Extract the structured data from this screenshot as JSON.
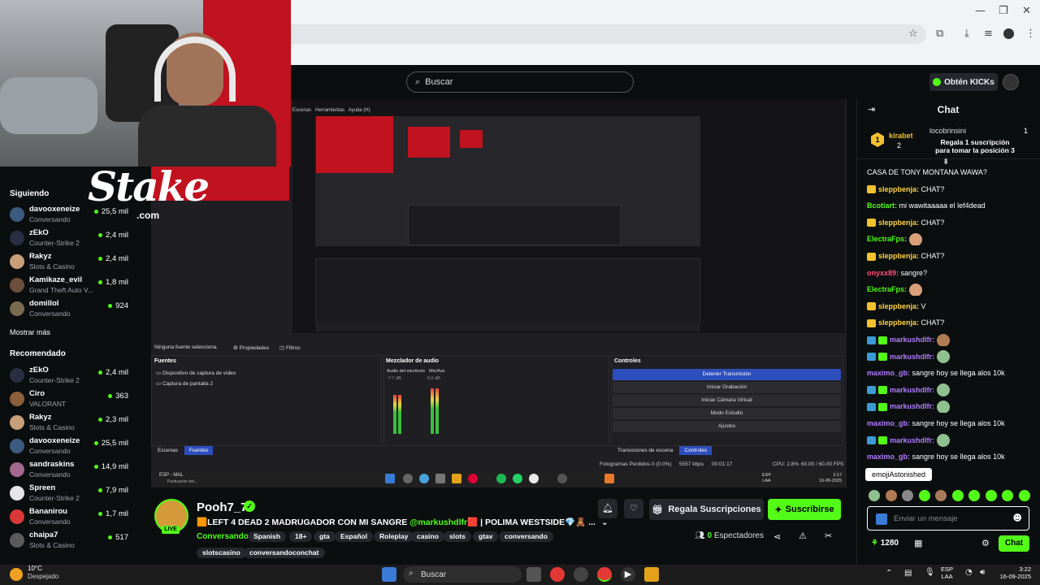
{
  "browser": {
    "icons": [
      "star-icon",
      "extensions-icon",
      "download-icon",
      "playlist-icon",
      "profile-icon",
      "menu-icon"
    ]
  },
  "header": {
    "search_placeholder": "Buscar",
    "kicks_label": "Obtén KICKs"
  },
  "webcam": {
    "sponsor": "Stake",
    "sponsor_domain": ".com"
  },
  "sidebar": {
    "following_title": "Siguiendo",
    "following": [
      {
        "name": "davooxeneize",
        "category": "Conversando",
        "viewers": "25,5 mil",
        "color": "#3d5a80"
      },
      {
        "name": "zEkO",
        "category": "Counter-Strike 2",
        "viewers": "2,4 mil",
        "color": "#2b2d42"
      },
      {
        "name": "Rakyz",
        "category": "Slots & Casino",
        "viewers": "2,4 mil",
        "color": "#c89f7a"
      },
      {
        "name": "Kamikaze_evil",
        "category": "Grand Theft Auto V...",
        "viewers": "1,8 mil",
        "color": "#6b4f3a"
      },
      {
        "name": "domillol",
        "category": "Conversando",
        "viewers": "924",
        "color": "#7a6a4f"
      }
    ],
    "show_more": "Mostrar más",
    "recommended_title": "Recomendado",
    "recommended": [
      {
        "name": "zEkO",
        "category": "Counter-Strike 2",
        "viewers": "2,4 mil",
        "color": "#2b2d42"
      },
      {
        "name": "Ciro",
        "category": "VALORANT",
        "viewers": "363",
        "color": "#8b5e3c"
      },
      {
        "name": "Rakyz",
        "category": "Slots & Casino",
        "viewers": "2,3 mil",
        "color": "#c89f7a"
      },
      {
        "name": "davooxeneize",
        "category": "Conversando",
        "viewers": "25,5 mil",
        "color": "#3d5a80"
      },
      {
        "name": "sandraskins",
        "category": "Conversando",
        "viewers": "14,9 mil",
        "color": "#a3688f"
      },
      {
        "name": "Spreen",
        "category": "Counter-Strike 2",
        "viewers": "7,9 mil",
        "color": "#e5e5e5"
      },
      {
        "name": "Bananirou",
        "category": "Conversando",
        "viewers": "1,7 mil",
        "color": "#d93838"
      },
      {
        "name": "chaipa7",
        "category": "Slots & Casino",
        "viewers": "517",
        "color": "#5a5a5a"
      }
    ]
  },
  "obs": {
    "menu": [
      "Escenas",
      "Herramientas",
      "Ayuda (H)"
    ],
    "no_source": "Ninguna fuente selecciona",
    "props": "Propiedades",
    "filters": "Filtros",
    "sources_title": "Fuentes",
    "sources": [
      "Dispositivo de captura de video",
      "Captura de pantalla 2"
    ],
    "mixer_title": "Mezclador de audio",
    "mixer_channels": [
      "Audio del escritorio",
      "Mic/Aux"
    ],
    "mixer_db": [
      "-7.7 dB",
      "-9.0 dB"
    ],
    "controls_title": "Controles",
    "controls": [
      "Detener Transmisión",
      "Iniciar Grabación",
      "Iniciar Cámara Virtual",
      "Modo Estudio",
      "Ajustes"
    ],
    "tabs_left": [
      "Escenas",
      "Fuentes"
    ],
    "tabs_right": [
      "Transiciones de escena",
      "Controles"
    ],
    "status": {
      "dropped": "Fotogramas Perdidos 0 (0.0%)",
      "kbps": "5557 kbps",
      "time": "00:01:17",
      "cpu": "CPU: 2.8%",
      "fps": "60.00 / 60.00 FPS"
    },
    "inner_taskbar": {
      "weather": "ESP - MAL",
      "sub": "Puntuación del...",
      "lang": "ESP",
      "lang2": "LAA",
      "time": "3:17",
      "date": "16-09-2025"
    }
  },
  "stream": {
    "channel": "Pooh7_7",
    "live": "LIVE",
    "title_pre": "🟧LEFT 4 DEAD 2 MADRUGADOR CON MI SANGRE ",
    "title_mention": "@markushdlfr",
    "title_post": "🟥 | POLIMA WESTSIDE💎🧸 ...",
    "category": "Conversando",
    "tags": [
      "Spanish",
      "18+",
      "gta",
      "Español",
      "Roleplay",
      "casino",
      "slots",
      "gtav",
      "conversando",
      "slotscasino",
      "conversandoconchat"
    ],
    "gift_label": "Regala Suscripciones",
    "subscribe_label": "Suscribirse",
    "viewers_count": "0",
    "viewers_label": "Espectadores"
  },
  "chat": {
    "title": "Chat",
    "leaderboard": {
      "user1": "kirabet",
      "user1_count": "2",
      "user2": "locobrinsini",
      "user2_count": "1",
      "cta": "Regala 1 suscripción para tomar la posición 3"
    },
    "messages": [
      {
        "user": "",
        "text": "CASA DE TONY MONTANA WAWA?",
        "color": "#ffffff"
      },
      {
        "user": "sleppbenja:",
        "text": "CHAT?",
        "color": "#ffd23f"
      },
      {
        "user": "Bcotiart:",
        "text": "mi wawitaaaaa el lef4dead",
        "color": "#53fc18"
      },
      {
        "user": "sleppbenja:",
        "text": "CHAT?",
        "color": "#ffd23f"
      },
      {
        "user": "ElectraFps:",
        "text": "",
        "color": "#53fc18"
      },
      {
        "user": "sleppbenja:",
        "text": "CHAT?",
        "color": "#ffd23f"
      },
      {
        "user": "onyxx89:",
        "text": "sangre?",
        "color": "#ff4f7b"
      },
      {
        "user": "ElectraFps:",
        "text": "",
        "color": "#53fc18"
      },
      {
        "user": "sleppbenja:",
        "text": "V",
        "color": "#ffd23f"
      },
      {
        "user": "sleppbenja:",
        "text": "CHAT?",
        "color": "#ffd23f"
      },
      {
        "user": "markushdlfr:",
        "text": "",
        "color": "#b07cff"
      },
      {
        "user": "markushdlfr:",
        "text": "",
        "color": "#b07cff"
      },
      {
        "user": "maximo_gb:",
        "text": "sangre hoy se llega alos 10k",
        "color": "#b07cff"
      },
      {
        "user": "markushdlfr:",
        "text": "",
        "color": "#b07cff"
      },
      {
        "user": "markushdlfr:",
        "text": "",
        "color": "#b07cff"
      },
      {
        "user": "maximo_gb:",
        "text": "sangre hoy se llega alos 10k",
        "color": "#b07cff"
      },
      {
        "user": "markushdlfr:",
        "text": "",
        "color": "#b07cff"
      },
      {
        "user": "maximo_gb:",
        "text": "sangre hoy se llega alos 10k",
        "color": "#b07cff"
      }
    ],
    "tooltip": "emojiAstonished",
    "input_placeholder": "Enviar un mensaje",
    "points": "1280",
    "send_label": "Chat"
  },
  "taskbar": {
    "weather_temp": "10°C",
    "weather_desc": "Despejado",
    "search": "Buscar",
    "lang": "ESP",
    "lang2": "LAA",
    "time": "3:22",
    "date": "16-09-2025"
  },
  "colors": {
    "kick_green": "#53fc18",
    "bg": "#0b0e0f",
    "obs_blue": "#2d4ebd"
  }
}
